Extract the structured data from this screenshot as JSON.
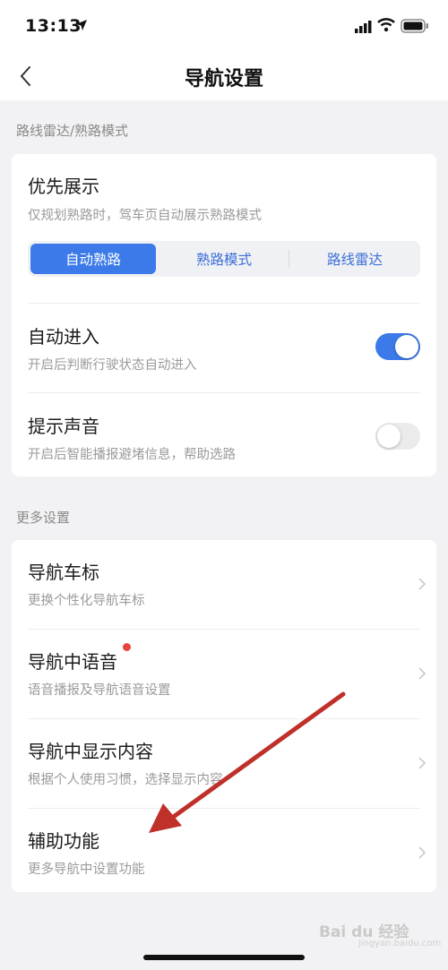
{
  "status": {
    "time": "13:13",
    "icons": [
      "location-icon",
      "signal-icon",
      "wifi-icon",
      "battery-icon"
    ]
  },
  "nav": {
    "title": "导航设置",
    "back_icon": "chevron-left-icon"
  },
  "section1": {
    "title": "路线雷达/熟路模式",
    "priority": {
      "title": "优先展示",
      "subtitle": "仅规划熟路时，驾车页自动展示熟路模式",
      "options": [
        "自动熟路",
        "熟路模式",
        "路线雷达"
      ],
      "selected": "自动熟路"
    },
    "auto_enter": {
      "title": "自动进入",
      "subtitle": "开启后判断行驶状态自动进入",
      "enabled": true
    },
    "sound": {
      "title": "提示声音",
      "subtitle": "开启后智能播报避堵信息，帮助选路",
      "enabled": false
    }
  },
  "section2": {
    "title": "更多设置",
    "items": [
      {
        "title": "导航车标",
        "subtitle": "更换个性化导航车标"
      },
      {
        "title": "导航中语音",
        "subtitle": "语音播报及导航语音设置",
        "badge": "red-dot"
      },
      {
        "title": "导航中显示内容",
        "subtitle": "根据个人使用习惯，选择显示内容"
      },
      {
        "title": "辅助功能",
        "subtitle": "更多导航中设置功能"
      }
    ]
  },
  "watermark": {
    "brand": "Bai du 经验",
    "url": "jingyan.baidu.com"
  },
  "colors": {
    "accent": "#3b7ae8",
    "badge": "#e8453c",
    "annotation_arrow": "#c0302a",
    "background": "#f2f2f4"
  }
}
